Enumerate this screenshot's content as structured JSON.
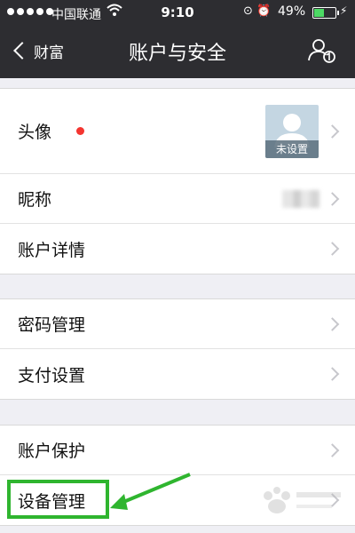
{
  "status_bar": {
    "carrier": "中国联通",
    "time": "9:10",
    "battery_percent": "49%",
    "battery_level": 0.49,
    "icons": [
      "signal-dots-icon",
      "wifi-icon",
      "rotation-lock-icon",
      "alarm-icon",
      "battery-icon",
      "charging-icon"
    ]
  },
  "nav": {
    "back_label": "财富",
    "title": "账户与安全",
    "right_icon": "person-switch-icon"
  },
  "groups": [
    {
      "rows": [
        {
          "label": "头像",
          "avatar_caption": "未设置",
          "badge": "red-dot"
        },
        {
          "label": "昵称"
        },
        {
          "label": "账户详情"
        }
      ]
    },
    {
      "rows": [
        {
          "label": "密码管理"
        },
        {
          "label": "支付设置"
        }
      ]
    },
    {
      "rows": [
        {
          "label": "账户保护"
        },
        {
          "label": "设备管理"
        }
      ]
    }
  ],
  "annotation": {
    "highlight_color": "#2fb52f",
    "arrow_icon": "green-arrow-icon"
  },
  "colors": {
    "topbar": "#2d2d31",
    "background": "#efeff4",
    "badge": "#f43530",
    "battery": "#4cd964"
  }
}
